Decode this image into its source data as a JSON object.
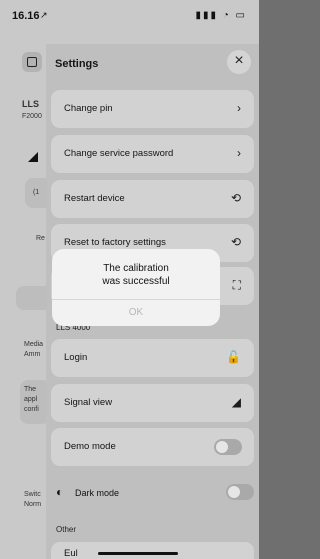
{
  "status_bar": {
    "time": "16.16",
    "location_glyph": "↗",
    "icons": "▮▮▮ ◔ ▭"
  },
  "background": {
    "logout_icon": "logout-icon",
    "device_name_partial": "LLS",
    "device_model_partial": "F2000",
    "card_partial": "(1",
    "re_partial": "Re",
    "media_partial": "Media",
    "media_value_partial": "Amm",
    "notice_partial_lines": [
      "The",
      "appl",
      "confi"
    ],
    "switch_partial": "Switc",
    "switch_value_partial": "Norm"
  },
  "settings": {
    "title": "Settings",
    "close_label": "×",
    "items": [
      {
        "label": "Change pin",
        "icon": "›"
      },
      {
        "label": "Change service password",
        "icon": "›"
      },
      {
        "label": "Restart device",
        "icon": "⟲"
      },
      {
        "label": "Reset to factory settings",
        "icon": "⟲"
      },
      {
        "label": "",
        "icon": "⛶"
      }
    ],
    "section_lls": "LLS 4000",
    "lls_items": [
      {
        "label": "Login",
        "icon": "🔓"
      },
      {
        "label": "Signal view",
        "icon": "◢"
      },
      {
        "label": "Demo mode",
        "toggle": false
      }
    ],
    "dark_mode_label": "Dark mode",
    "dark_mode_icon": "◐",
    "other_label": "Other",
    "last_item_partial": "Eul"
  },
  "dialog": {
    "message_line1": "The calibration",
    "message_line2": "was successful",
    "ok_label": "OK"
  }
}
